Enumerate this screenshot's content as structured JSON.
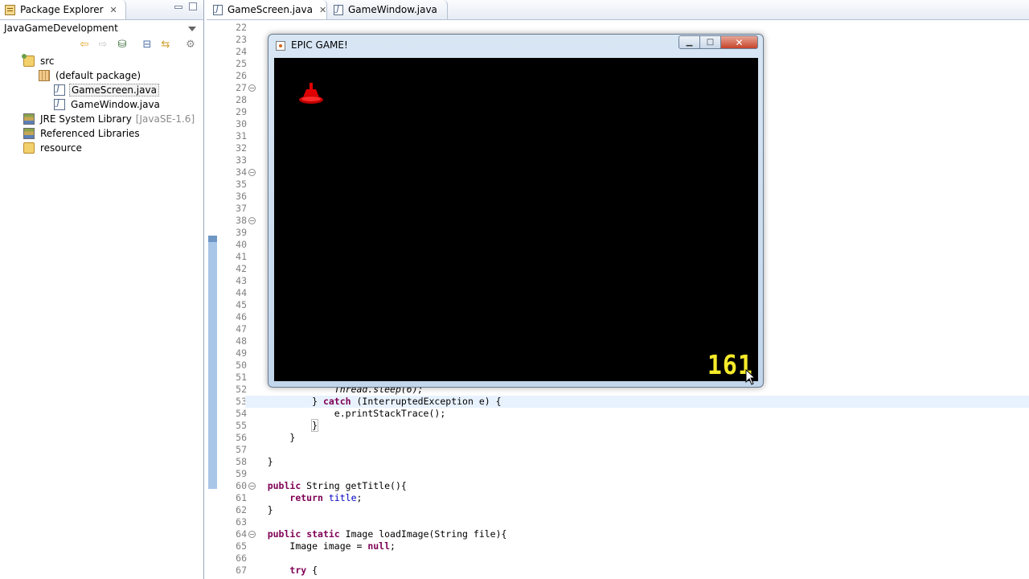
{
  "package_explorer": {
    "tab_label": "Package Explorer",
    "project_name": "JavaGameDevelopment",
    "tree": {
      "src": "src",
      "default_package": "(default package)",
      "file1": "GameScreen.java",
      "file2": "GameWindow.java",
      "jre_label": "JRE System Library",
      "jre_version": "[JavaSE-1.6]",
      "ref_libs": "Referenced Libraries",
      "resource": "resource"
    }
  },
  "editor": {
    "tabs": [
      "GameScreen.java",
      "GameWindow.java"
    ],
    "active_tab": 0,
    "line_numbers": [
      "22",
      "23",
      "24",
      "25",
      "26",
      "27",
      "28",
      "29",
      "30",
      "31",
      "32",
      "33",
      "34",
      "35",
      "36",
      "37",
      "38",
      "39",
      "40",
      "41",
      "42",
      "43",
      "44",
      "45",
      "46",
      "47",
      "48",
      "49",
      "50",
      "51",
      "52",
      "53",
      "54",
      "55",
      "56",
      "57",
      "58",
      "59",
      "60",
      "61",
      "62",
      "63",
      "64",
      "65",
      "66",
      "67"
    ],
    "fold_lines": [
      "27",
      "34",
      "38",
      "60",
      "64"
    ],
    "code_visible": {
      "l52": "Thread.sleep(6);",
      "l53_pre": "} ",
      "l53_kw": "catch",
      "l53_post": " (InterruptedException e) {",
      "l54": "e.printStackTrace();",
      "l55": "}",
      "l56": "}",
      "l58": "}",
      "l60_kw": "public",
      "l60_post": " String getTitle(){",
      "l61_kw": "return",
      "l61_field": "title",
      "l61_post": ";",
      "l62": "}",
      "l64_kw1": "public",
      "l64_kw2": "static",
      "l64_post": " Image loadImage(String file){",
      "l65_pre": "Image image = ",
      "l65_kw": "null",
      "l65_post": ";",
      "l67_kw": "try",
      "l67_post": " {"
    }
  },
  "game_window": {
    "title": "EPIC GAME!",
    "score": "161",
    "colors": {
      "background": "#000000",
      "ship": "#e00000",
      "score": "#f5ea2a"
    }
  },
  "icons": [
    "close-icon",
    "minimize-icon",
    "maximize-icon",
    "java-file-icon",
    "folder-icon",
    "package-icon",
    "library-icon",
    "back-arrow-icon",
    "forward-arrow-icon",
    "collapse-all-icon",
    "link-editor-icon",
    "view-menu-icon",
    "java-cup-icon",
    "mouse-cursor-icon"
  ]
}
